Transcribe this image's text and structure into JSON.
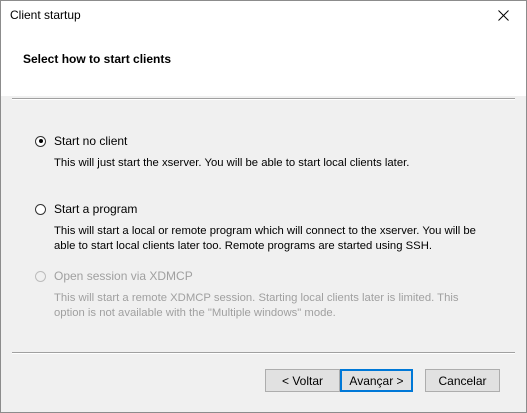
{
  "window": {
    "title": "Client startup"
  },
  "header": {
    "title": "Select how to start clients"
  },
  "options": [
    {
      "label": "Start no client",
      "description": "This will just start the xserver. You will be able to start local clients later.",
      "checked": true,
      "enabled": true
    },
    {
      "label": "Start a program",
      "description": "This will start a local or remote program which will connect to the xserver. You will be able to start local clients later too. Remote programs are started using SSH.",
      "checked": false,
      "enabled": true
    },
    {
      "label": "Open session via XDMCP",
      "description": "This will start a remote XDMCP session. Starting local clients later is limited. This option is not available with the \"Multiple windows\" mode.",
      "checked": false,
      "enabled": false
    }
  ],
  "buttons": {
    "back": "< Voltar",
    "next": "Avançar >",
    "cancel": "Cancelar"
  },
  "icons": {
    "close": "close-icon"
  },
  "colors": {
    "default_button_border": "#0078d7",
    "disabled_text": "#a0a0a0"
  }
}
